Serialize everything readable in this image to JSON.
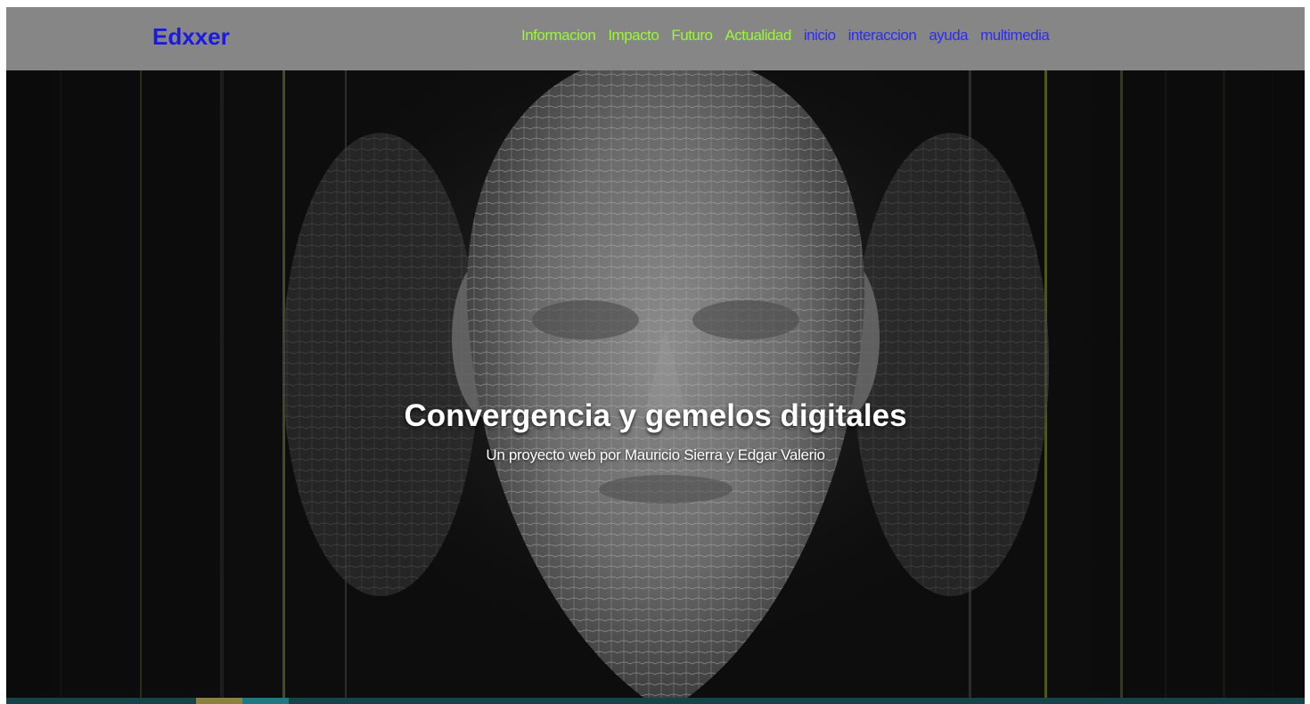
{
  "navbar": {
    "brand": "Edxxer",
    "links": [
      {
        "label": "Informacion",
        "color": "#9cf63d"
      },
      {
        "label": "Impacto",
        "color": "#9cf63d"
      },
      {
        "label": "Futuro",
        "color": "#9cf63d"
      },
      {
        "label": "Actualidad",
        "color": "#9cf63d"
      },
      {
        "label": "inicio",
        "color": "#2d2df0"
      },
      {
        "label": "interaccion",
        "color": "#2d2df0"
      },
      {
        "label": "ayuda",
        "color": "#2d2df0"
      },
      {
        "label": "multimedia",
        "color": "#2d2df0"
      }
    ]
  },
  "hero": {
    "title": "Convergencia y gemelos digitales",
    "subtitle": "Un proyecto web por Mauricio Sierra y Edgar Valerio",
    "background": "wireframe-face-image"
  },
  "colors": {
    "navbar_bg": "#868686",
    "brand": "#1a1ae0",
    "bottom_bar": "#14454a",
    "bottom_seg_olive": "#8a8040",
    "bottom_seg_teal": "#1e7a80"
  }
}
